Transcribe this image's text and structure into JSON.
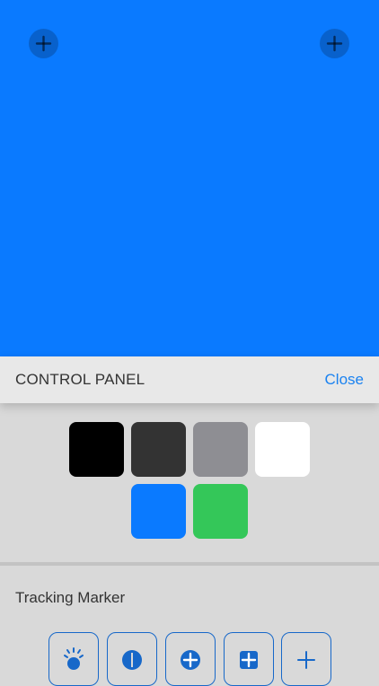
{
  "canvas": {
    "background": "#0A7AFF",
    "left_add_icon": "plus-circle-icon",
    "right_add_icon": "plus-circle-icon"
  },
  "panel": {
    "title": "CONTROL PANEL",
    "close_label": "Close",
    "accent": "#1A82F0"
  },
  "swatches": [
    {
      "name": "black",
      "color": "#000000"
    },
    {
      "name": "dark-gray",
      "color": "#333333"
    },
    {
      "name": "gray",
      "color": "#8E8E93"
    },
    {
      "name": "white",
      "color": "#FFFFFF"
    },
    {
      "name": "blue",
      "color": "#0A7AFF"
    },
    {
      "name": "green",
      "color": "#34C759"
    }
  ],
  "tracking": {
    "label": "Tracking Marker",
    "marker_color": "#1768C9",
    "markers": [
      {
        "icon": "sun-marker-icon"
      },
      {
        "icon": "filled-circle-marker-icon"
      },
      {
        "icon": "plus-circle-marker-icon"
      },
      {
        "icon": "plus-square-marker-icon"
      },
      {
        "icon": "crosshair-plus-marker-icon"
      }
    ]
  }
}
